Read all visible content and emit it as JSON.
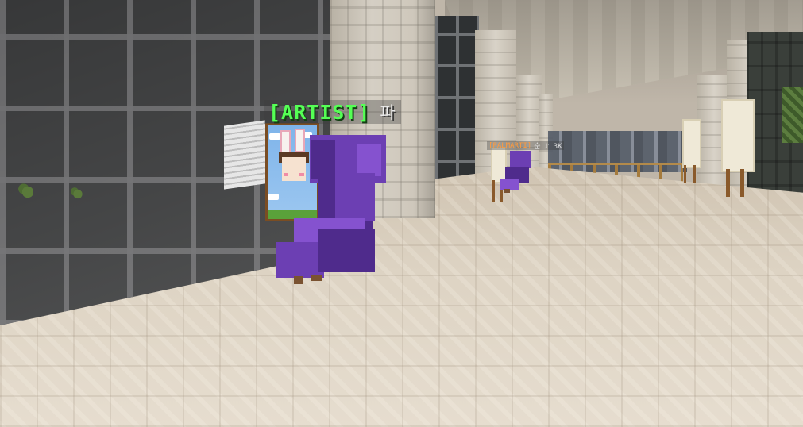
{
  "scene": {
    "description_colors": {
      "accent_rank": "#55ff55",
      "player_outfit": "#6c3fb3",
      "far_rank": "#ff9a3c"
    }
  },
  "hud": {
    "nametag_main": {
      "rank": "[ARTIST]",
      "player": "파"
    },
    "nametag_far": {
      "rank": "[PALMARTI]",
      "player": "순 ♪ 3K"
    }
  },
  "icons": {
    "plant": "plant-icon",
    "easel": "easel-icon"
  }
}
